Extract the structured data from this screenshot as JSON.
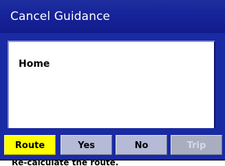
{
  "dialog": {
    "title": "Cancel Guidance"
  },
  "destination_field": {
    "value": "Home"
  },
  "buttons": [
    {
      "label": "Route",
      "state": "selected"
    },
    {
      "label": "Yes",
      "state": "enabled"
    },
    {
      "label": "No",
      "state": "enabled"
    },
    {
      "label": "Trip",
      "state": "disabled"
    }
  ],
  "status": {
    "text": "Re-calculate the route."
  },
  "colors": {
    "title_bar": "#17249a",
    "panel": "#1a2aa3",
    "selected_button": "#ffff00",
    "button": "#b5bbd6",
    "disabled_text": "#d6d9e6"
  }
}
